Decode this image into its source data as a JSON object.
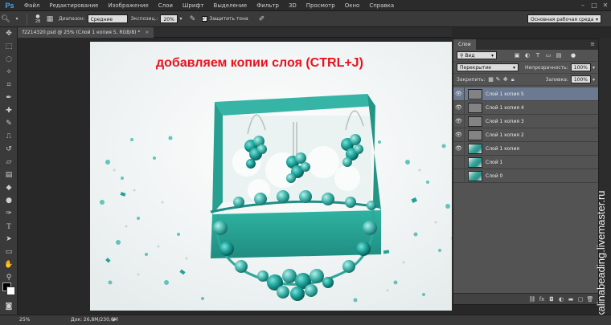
{
  "app": {
    "logo": "Ps",
    "menu": [
      "Файл",
      "Редактирование",
      "Изображение",
      "Слои",
      "Шрифт",
      "Выделение",
      "Фильтр",
      "3D",
      "Просмотр",
      "Окно",
      "Справка"
    ],
    "window_controls": [
      "–",
      "□",
      "✕"
    ]
  },
  "options_bar": {
    "brush_size": "28",
    "range_label": "Диапазон:",
    "range_value": "Средние тона",
    "exposure_label": "Экспозиц.:",
    "exposure_value": "20%",
    "protect_tones_label": "Защитить тона",
    "protect_tones_checked": true,
    "workspace": "Основная рабочая среда"
  },
  "document": {
    "tab_title": "f2214320.psd @ 25% (Слой 1 копия 5, RGB/8) *",
    "tab_close": "×",
    "caption": "добавляем копии слоя (CTRL+J)"
  },
  "layers_panel": {
    "tab_label": "Слои",
    "filter_value": "Вид",
    "blend_mode": "Перекрытие",
    "opacity_label": "Непрозрачность:",
    "opacity_value": "100%",
    "lock_label": "Закрепить:",
    "fill_label": "Заливка:",
    "fill_value": "100%",
    "layers": [
      {
        "name": "Слой 1 копия 5",
        "visible": true,
        "thumb": "empty",
        "selected": true
      },
      {
        "name": "Слой 1 копия 4",
        "visible": true,
        "thumb": "empty",
        "selected": false
      },
      {
        "name": "Слой 1 копия 3",
        "visible": true,
        "thumb": "empty",
        "selected": false
      },
      {
        "name": "Слой 1 копия 2",
        "visible": true,
        "thumb": "empty",
        "selected": false
      },
      {
        "name": "Слой 1 копия",
        "visible": true,
        "thumb": "photo",
        "selected": false
      },
      {
        "name": "Слой 1",
        "visible": false,
        "thumb": "photo",
        "selected": false
      },
      {
        "name": "Слой 0",
        "visible": false,
        "thumb": "photo",
        "selected": false
      }
    ],
    "bottom_icons": [
      "link-icon",
      "fx-icon",
      "mask-icon",
      "adjustment-icon",
      "folder-icon",
      "new-layer-icon",
      "trash-icon"
    ]
  },
  "status_bar": {
    "zoom": "25%",
    "doc_size": "Док: 26,8M/230,6M",
    "arrow": "▶"
  },
  "watermark": "kalinabeading.livemaster.ru",
  "colors": {
    "caption_red": "#e8121e",
    "box_teal": "#2fa898",
    "selected_layer": "#6b7a91",
    "ps_blue": "#3ea9f5"
  }
}
